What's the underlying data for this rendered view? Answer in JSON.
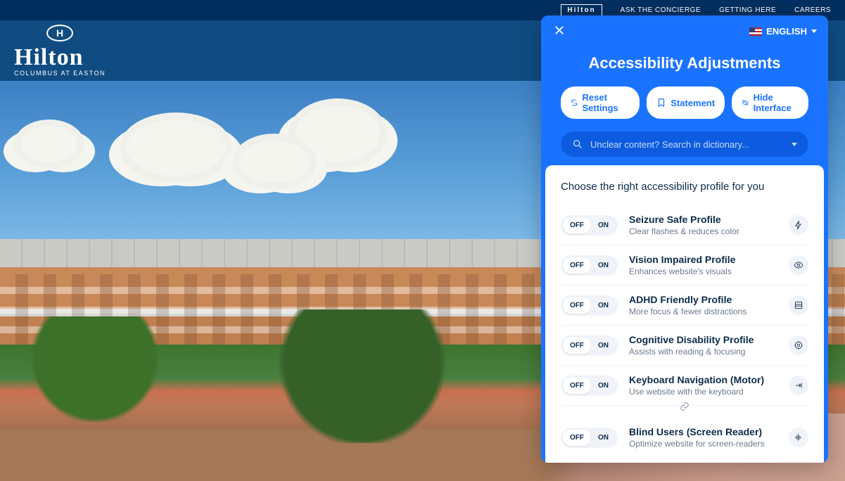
{
  "topbar": {
    "brand": "Hilton",
    "links": [
      "ASK THE CONCIERGE",
      "GETTING HERE",
      "CAREERS"
    ]
  },
  "logo": {
    "glyph": "H",
    "word": "Hilton",
    "sub": "COLUMBUS AT EASTON"
  },
  "panel": {
    "language": "ENGLISH",
    "title": "Accessibility Adjustments",
    "buttons": {
      "reset": "Reset Settings",
      "statement": "Statement",
      "hide": "Hide Interface"
    },
    "search_placeholder": "Unclear content? Search in dictionary...",
    "card_title": "Choose the right accessibility profile for you",
    "toggle": {
      "off": "OFF",
      "on": "ON"
    },
    "profiles": [
      {
        "name": "Seizure Safe Profile",
        "desc": "Clear flashes & reduces color"
      },
      {
        "name": "Vision Impaired Profile",
        "desc": "Enhances website's visuals"
      },
      {
        "name": "ADHD Friendly Profile",
        "desc": "More focus & fewer distractions"
      },
      {
        "name": "Cognitive Disability Profile",
        "desc": "Assists with reading & focusing"
      },
      {
        "name": "Keyboard Navigation (Motor)",
        "desc": "Use website with the keyboard"
      },
      {
        "name": "Blind Users (Screen Reader)",
        "desc": "Optimize website for screen-readers"
      }
    ]
  }
}
